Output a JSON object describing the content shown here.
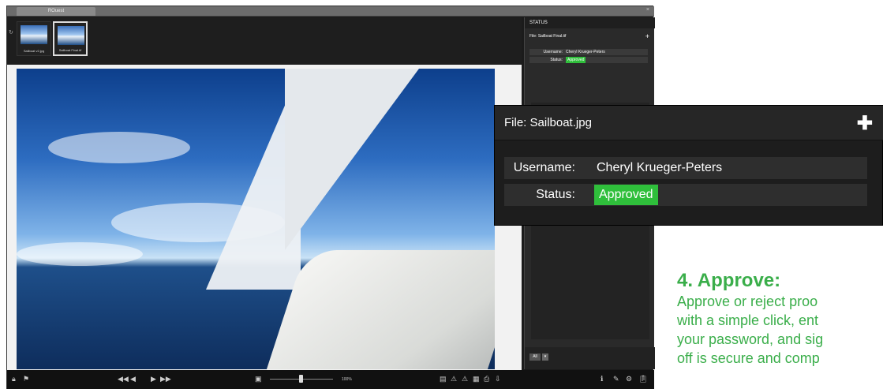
{
  "app": {
    "tab_title": "ROuest",
    "thumbnails": [
      {
        "caption": "Sailboat v2.jpg"
      },
      {
        "caption": "Sailboat Final.tif"
      }
    ]
  },
  "viewer": {
    "zoom_label": "100%"
  },
  "status_panel": {
    "header": "STATUS",
    "file_label": "File:",
    "file_name": "Sailboat Final.tif",
    "username_label": "Username:",
    "username_value": "Cheryl Krueger-Peters",
    "status_label": "Status:",
    "status_value": "Approved",
    "filter_label": "All"
  },
  "callout": {
    "file_label": "File:",
    "file_name": "Sailboat.jpg",
    "username_label": "Username:",
    "username_value": "Cheryl Krueger-Peters",
    "status_label": "Status:",
    "status_value": "Approved"
  },
  "step": {
    "title": "4. Approve:",
    "lines": [
      "Approve or reject proo",
      "with a simple click, ent",
      "your password, and sig",
      "off is secure and comp"
    ]
  },
  "colors": {
    "approved": "#2fbf3b",
    "accent_text": "#3aae4a"
  }
}
